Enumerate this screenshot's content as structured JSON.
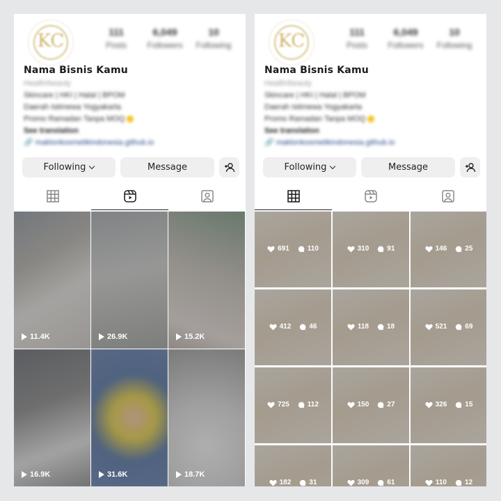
{
  "profile": {
    "monogram": "KC",
    "posts_count": "111",
    "posts_label": "Posts",
    "followers_count": "6,049",
    "followers_label": "Followers",
    "following_count": "10",
    "following_label": "Following",
    "name": "Nama Bisnis Kamu",
    "category": "Health/beauty",
    "bio_line1": "Skincare | HKI | Halal | BPOM",
    "bio_line2": "Daerah Istimewa Yogyakarta",
    "bio_line3": "Promo Ramadan Tanpa MOQ",
    "see_translation": "See translation",
    "link": "maklonkosmetikindonesia.github.io"
  },
  "actions": {
    "following_label": "Following",
    "message_label": "Message"
  },
  "reels": [
    {
      "views": "11.4K",
      "color": "#cfcac4"
    },
    {
      "views": "26.9K",
      "color": "#bdbdbd"
    },
    {
      "views": "15.2K",
      "color": "#c9c2bb"
    },
    {
      "views": "16.9K",
      "color": "#a9a9a9"
    },
    {
      "views": "31.6K",
      "color": "#9aa0b0"
    },
    {
      "views": "18.7K",
      "color": "#d8d8d8"
    }
  ],
  "posts": [
    {
      "likes": "691",
      "comments": "110"
    },
    {
      "likes": "310",
      "comments": "91"
    },
    {
      "likes": "146",
      "comments": "25"
    },
    {
      "likes": "412",
      "comments": "46"
    },
    {
      "likes": "118",
      "comments": "18"
    },
    {
      "likes": "521",
      "comments": "69"
    },
    {
      "likes": "725",
      "comments": "112"
    },
    {
      "likes": "150",
      "comments": "27"
    },
    {
      "likes": "326",
      "comments": "15"
    },
    {
      "likes": "182",
      "comments": "31"
    },
    {
      "likes": "309",
      "comments": "61"
    },
    {
      "likes": "110",
      "comments": "12"
    }
  ],
  "colors": {
    "post_tile": "#efe6d6",
    "active_tab": "#222222",
    "button_bg": "#efefef"
  }
}
